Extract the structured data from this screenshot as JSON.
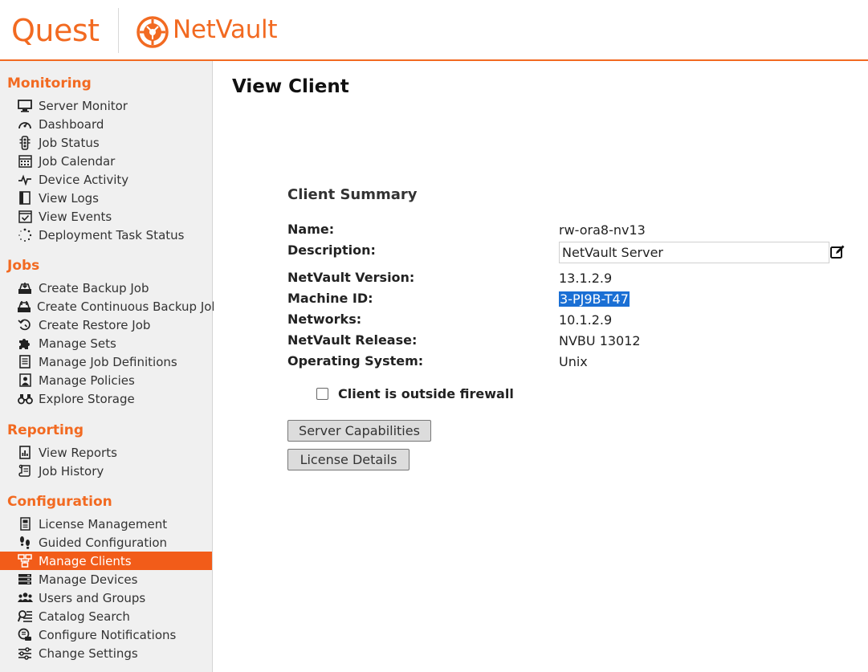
{
  "header": {
    "quest_logo": "Quest",
    "product_logo": "NetVault"
  },
  "sidebar": {
    "sections": [
      {
        "title": "Monitoring",
        "items": [
          {
            "label": "Server Monitor",
            "icon": "monitor-icon"
          },
          {
            "label": "Dashboard",
            "icon": "dashboard-icon"
          },
          {
            "label": "Job Status",
            "icon": "traffic-light-icon"
          },
          {
            "label": "Job Calendar",
            "icon": "calendar-icon"
          },
          {
            "label": "Device Activity",
            "icon": "pulse-icon"
          },
          {
            "label": "View Logs",
            "icon": "log-book-icon"
          },
          {
            "label": "View Events",
            "icon": "events-check-icon"
          },
          {
            "label": "Deployment Task Status",
            "icon": "spinner-icon"
          }
        ]
      },
      {
        "title": "Jobs",
        "items": [
          {
            "label": "Create Backup Job",
            "icon": "backup-icon"
          },
          {
            "label": "Create Continuous Backup Job",
            "icon": "continuous-backup-icon"
          },
          {
            "label": "Create Restore Job",
            "icon": "restore-icon"
          },
          {
            "label": "Manage Sets",
            "icon": "puzzle-icon"
          },
          {
            "label": "Manage Job Definitions",
            "icon": "document-icon"
          },
          {
            "label": "Manage Policies",
            "icon": "policy-icon"
          },
          {
            "label": "Explore Storage",
            "icon": "binoculars-icon"
          }
        ]
      },
      {
        "title": "Reporting",
        "items": [
          {
            "label": "View Reports",
            "icon": "report-icon"
          },
          {
            "label": "Job History",
            "icon": "scroll-icon"
          }
        ]
      },
      {
        "title": "Configuration",
        "items": [
          {
            "label": "License Management",
            "icon": "license-icon"
          },
          {
            "label": "Guided Configuration",
            "icon": "footsteps-icon"
          },
          {
            "label": "Manage Clients",
            "icon": "clients-icon",
            "active": true
          },
          {
            "label": "Manage Devices",
            "icon": "devices-icon"
          },
          {
            "label": "Users and Groups",
            "icon": "users-icon"
          },
          {
            "label": "Catalog Search",
            "icon": "catalog-search-icon"
          },
          {
            "label": "Configure Notifications",
            "icon": "notifications-icon"
          },
          {
            "label": "Change Settings",
            "icon": "settings-sliders-icon"
          }
        ]
      }
    ]
  },
  "main": {
    "page_title": "View Client",
    "summary_title": "Client Summary",
    "fields": {
      "name_label": "Name:",
      "name_value": "rw-ora8-nv13",
      "description_label": "Description:",
      "description_value": "NetVault Server",
      "version_label": "NetVault Version:",
      "version_value": "13.1.2.9",
      "machine_id_label": "Machine ID:",
      "machine_id_value": "3-PJ9B-T47",
      "networks_label": "Networks:",
      "networks_value": "10.1.2.9",
      "release_label": "NetVault Release:",
      "release_value": "NVBU 13012",
      "os_label": "Operating System:",
      "os_value": "Unix"
    },
    "firewall_checkbox_label": "Client is outside firewall",
    "firewall_checked": false,
    "server_capabilities_button": "Server Capabilities",
    "license_details_button": "License Details"
  },
  "colors": {
    "accent": "#f26a21",
    "active_nav": "#f25c19",
    "selection": "#1a6fd4"
  }
}
